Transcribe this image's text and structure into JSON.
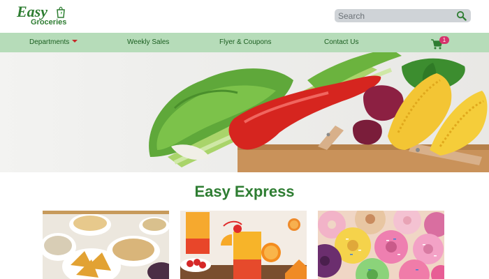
{
  "brand": {
    "logo_word": "Easy",
    "logo_sub": "Groceries"
  },
  "search": {
    "placeholder": "Search",
    "value": ""
  },
  "nav": {
    "items": [
      {
        "label": "Departments",
        "has_dropdown": true
      },
      {
        "label": "Weekly Sales"
      },
      {
        "label": "Flyer & Coupons"
      },
      {
        "label": "Contact Us"
      }
    ],
    "cart_count": "1"
  },
  "hero": {
    "slide_count": 4,
    "active_slide": 3
  },
  "section": {
    "title": "Easy Express"
  },
  "cards": [
    {
      "name": "snacks"
    },
    {
      "name": "drinks"
    },
    {
      "name": "donuts"
    }
  ],
  "colors": {
    "brand_green": "#2e7d32",
    "nav_bg": "#b6dcb9",
    "badge": "#d6336c",
    "caret": "#c62828"
  }
}
